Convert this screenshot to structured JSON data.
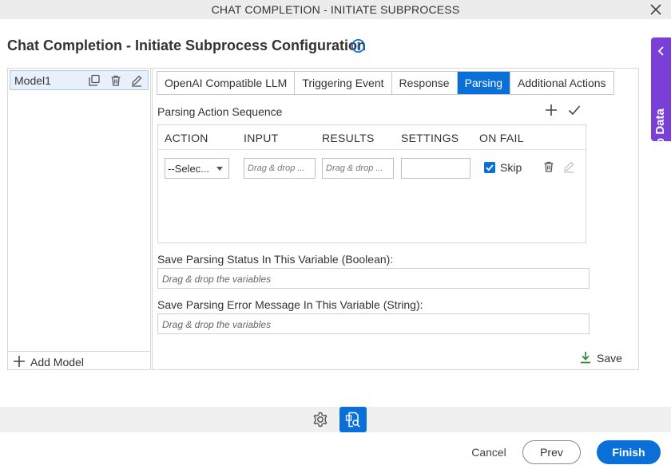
{
  "window": {
    "title": "CHAT COMPLETION - INITIATE SUBPROCESS"
  },
  "page": {
    "heading": "Chat Completion - Initiate Subprocess Configuration"
  },
  "app_data": {
    "label": "App Data"
  },
  "models": {
    "items": [
      {
        "label": "Model1"
      }
    ],
    "add_label": "Add Model"
  },
  "tabs": [
    {
      "label": "OpenAI Compatible LLM",
      "active": false
    },
    {
      "label": "Triggering Event",
      "active": false
    },
    {
      "label": "Response",
      "active": false
    },
    {
      "label": "Parsing",
      "active": true
    },
    {
      "label": "Additional Actions",
      "active": false
    }
  ],
  "parsing": {
    "sequence_label": "Parsing Action Sequence",
    "columns": [
      "ACTION",
      "INPUT",
      "RESULTS",
      "SETTINGS",
      "ON FAIL"
    ],
    "rows": [
      {
        "action": "--Selec...",
        "input_placeholder": "Drag & drop ...",
        "results_placeholder": "Drag & drop ...",
        "settings": "",
        "on_fail_checked": true,
        "on_fail_label": "Skip"
      }
    ],
    "status_label": "Save Parsing Status In This Variable (Boolean):",
    "status_placeholder": "Drag & drop the variables",
    "error_label": "Save Parsing Error Message In This Variable (String):",
    "error_placeholder": "Drag & drop the variables",
    "save_label": "Save"
  },
  "footer": {
    "cancel": "Cancel",
    "prev": "Prev",
    "finish": "Finish"
  },
  "colors": {
    "accent": "#0a6fd6",
    "app_data": "#7a3fd6",
    "save_icon": "#2e8b3a"
  }
}
